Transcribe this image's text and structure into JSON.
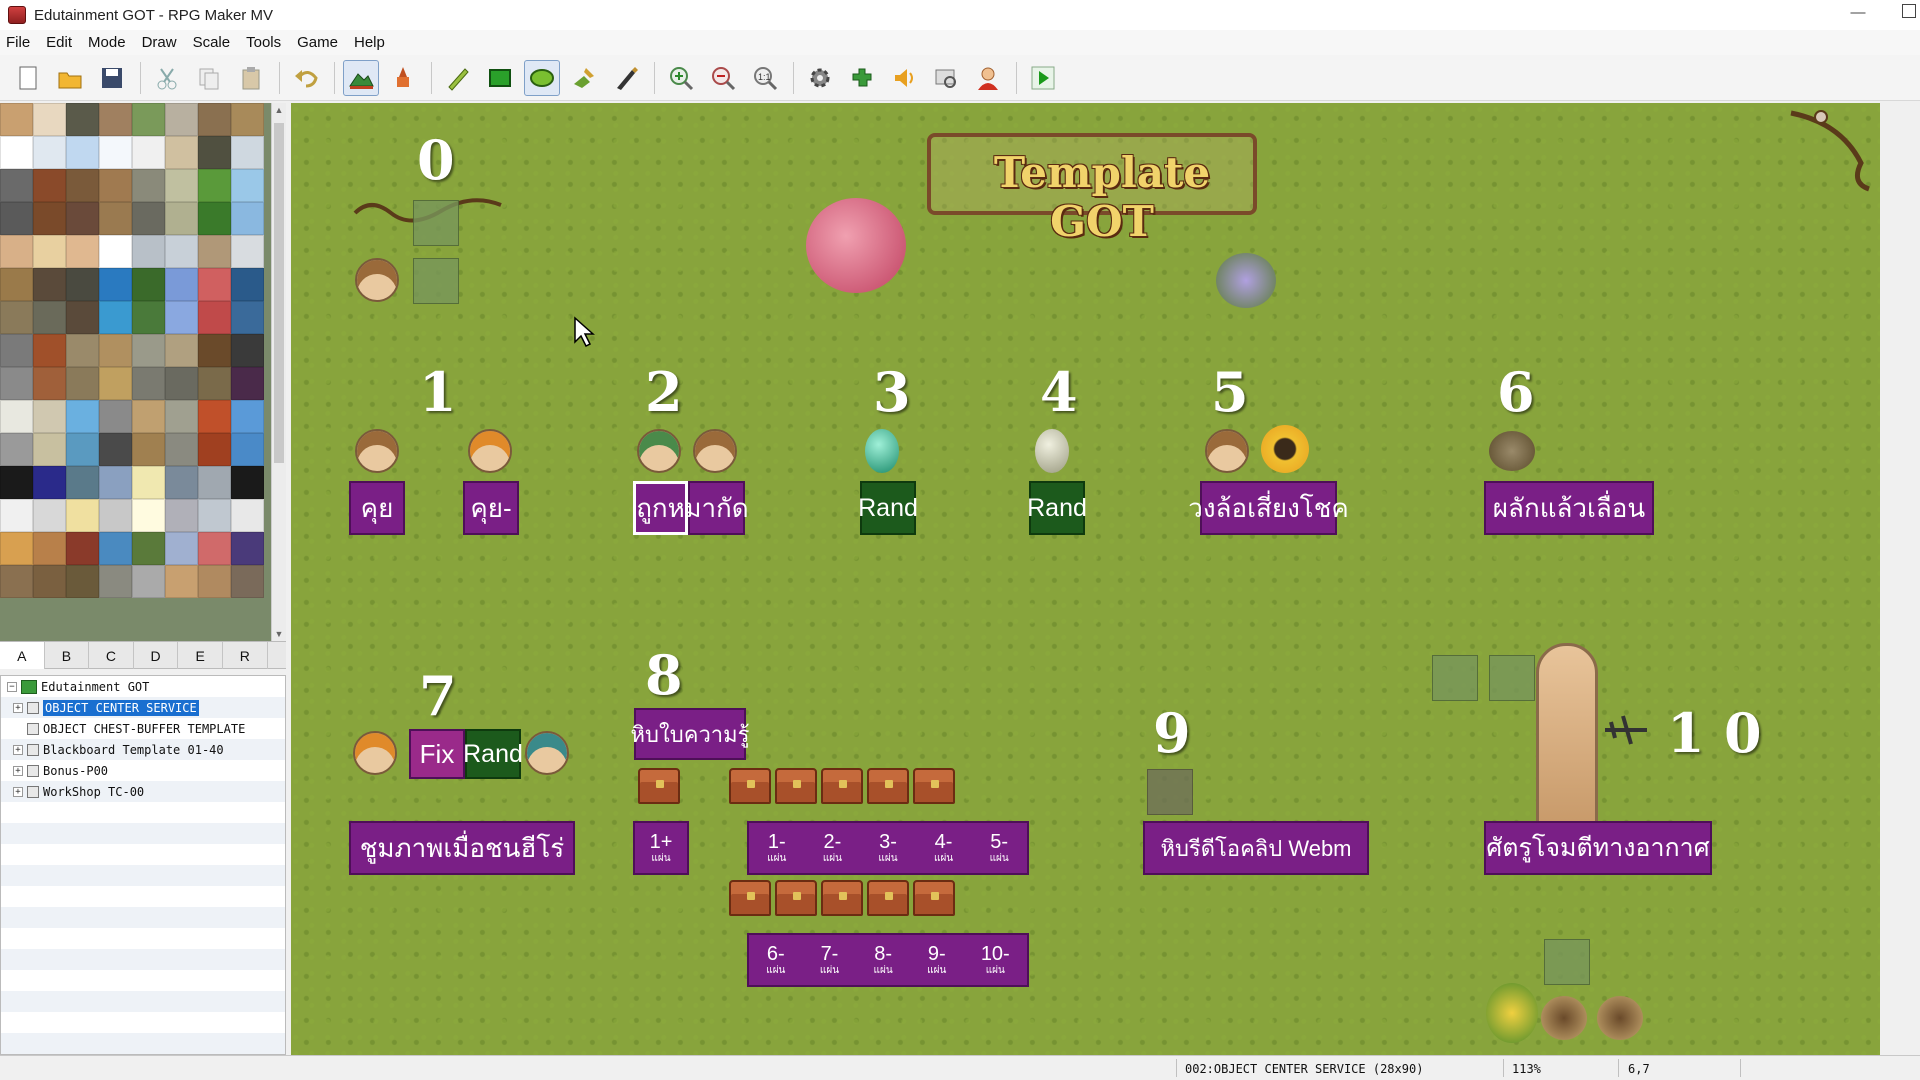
{
  "window": {
    "title": "Edutainment GOT - RPG Maker MV",
    "minimize": "—"
  },
  "menu": [
    "File",
    "Edit",
    "Mode",
    "Draw",
    "Scale",
    "Tools",
    "Game",
    "Help"
  ],
  "toolbar": [
    {
      "icon": "new-project-icon"
    },
    {
      "icon": "open-project-icon"
    },
    {
      "icon": "save-project-icon"
    },
    {
      "sep": true
    },
    {
      "icon": "cut-icon"
    },
    {
      "icon": "copy-icon"
    },
    {
      "icon": "paste-icon"
    },
    {
      "sep": true
    },
    {
      "icon": "undo-icon"
    },
    {
      "sep": true
    },
    {
      "icon": "map-mode-icon",
      "active": true
    },
    {
      "icon": "event-mode-icon"
    },
    {
      "sep": true
    },
    {
      "icon": "pencil-icon"
    },
    {
      "icon": "rectangle-icon"
    },
    {
      "icon": "ellipse-icon",
      "active": true
    },
    {
      "icon": "fill-icon"
    },
    {
      "icon": "shadow-pen-icon"
    },
    {
      "sep": true
    },
    {
      "icon": "zoom-in-icon"
    },
    {
      "icon": "zoom-out-icon"
    },
    {
      "icon": "zoom-actual-icon"
    },
    {
      "sep": true
    },
    {
      "icon": "database-icon"
    },
    {
      "icon": "plugin-manager-icon"
    },
    {
      "icon": "sound-test-icon"
    },
    {
      "icon": "event-searcher-icon"
    },
    {
      "icon": "character-generator-icon"
    },
    {
      "sep": true
    },
    {
      "icon": "playtest-icon"
    }
  ],
  "palette_tabs": [
    {
      "label": "A",
      "active": true
    },
    {
      "label": "B"
    },
    {
      "label": "C"
    },
    {
      "label": "D"
    },
    {
      "label": "E"
    },
    {
      "label": "R"
    }
  ],
  "tree": [
    {
      "label": "Edutainment GOT",
      "root": true,
      "expander": "−"
    },
    {
      "label": "OBJECT CENTER SERVICE",
      "expander": "+",
      "selected": true
    },
    {
      "label": "OBJECT CHEST-BUFFER TEMPLATE"
    },
    {
      "label": "Blackboard Template 01-40",
      "expander": "+"
    },
    {
      "label": "Bonus-P00",
      "expander": "+"
    },
    {
      "label": "WorkShop TC-00",
      "expander": "+"
    }
  ],
  "map": {
    "sign": "Template GOT",
    "numbers": [
      "0",
      "1",
      "2",
      "3",
      "4",
      "5",
      "6",
      "7",
      "8",
      "9",
      "1",
      "0"
    ],
    "labels": {
      "talk": "คุย",
      "talk_minus": "คุย-",
      "correct_left": "ถูกห",
      "correct_right": "มากัด",
      "rand3": "Rand",
      "rand4": "Rand",
      "wheel": "วงล้อเสี่ยงโชค",
      "push": "ผลักแล้วเลื่อน",
      "fix": "Fix",
      "rand7": "Rand",
      "hero": "ชูมภาพเมื่อชนฮีโร่",
      "card": "หิบใบความรู้",
      "one_plus": "1+",
      "one_plus_unit": "แผ่น",
      "video": "หิบรีดีโอคลิป Webm",
      "air": "ศัตรูโจมตีทางอากาศ"
    },
    "minus_counts": [
      {
        "n": "1-",
        "u": "แผ่น"
      },
      {
        "n": "2-",
        "u": "แผ่น"
      },
      {
        "n": "3-",
        "u": "แผ่น"
      },
      {
        "n": "4-",
        "u": "แผ่น"
      },
      {
        "n": "5-",
        "u": "แผ่น"
      }
    ],
    "minus_counts2": [
      {
        "n": "6-",
        "u": "แผ่น"
      },
      {
        "n": "7-",
        "u": "แผ่น"
      },
      {
        "n": "8-",
        "u": "แผ่น"
      },
      {
        "n": "9-",
        "u": "แผ่น"
      },
      {
        "n": "10-",
        "u": "แผ่น"
      }
    ]
  },
  "status": {
    "map_info": "002:OBJECT CENTER SERVICE (28x90)",
    "zoom": "113%",
    "coords": "6,7"
  },
  "colors": {
    "grass": "#88a43c",
    "label_purple": "#7a1f86",
    "label_green": "#1c5a1c",
    "selection_blue": "#1a6fd0"
  }
}
